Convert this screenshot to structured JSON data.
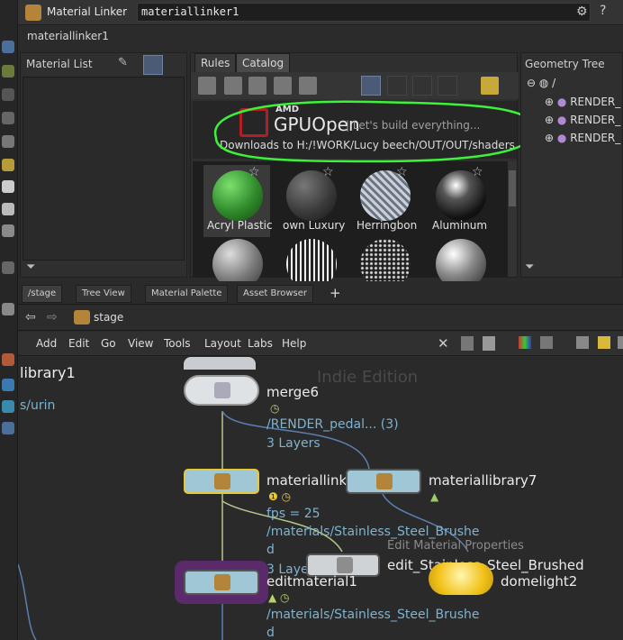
{
  "app": {
    "title": "Material Linker",
    "node_name": "materiallinker1",
    "node_path": "materiallinker1"
  },
  "panels": {
    "material_list": {
      "title": "Material List"
    },
    "catalog": {
      "tabs": [
        {
          "label": "Rules"
        },
        {
          "label": "Catalog"
        }
      ],
      "banner": {
        "brand_top": "AMD",
        "brand_main": "GPUOpen",
        "tagline": "| Let's build everything...",
        "download": "Downloads to H:/!WORK/Lucy beech/OUT/OUT/shaders"
      },
      "thumbnails": [
        {
          "label": "Acryl Plastic",
          "color": "#2f8a2a"
        },
        {
          "label": "own Luxury",
          "color": "#3b3b3b"
        },
        {
          "label": "Herringbon",
          "color": "#9aa3b0"
        },
        {
          "label": "Aluminum",
          "color": "#1d1d1d"
        }
      ]
    },
    "geometry_tree": {
      "title": "Geometry Tree",
      "root": "/",
      "items": [
        {
          "label": "RENDER_"
        },
        {
          "label": "RENDER_"
        },
        {
          "label": "RENDER_"
        }
      ]
    }
  },
  "network_tabs": [
    {
      "label": "/stage"
    },
    {
      "label": "Tree View"
    },
    {
      "label": "Material Palette"
    },
    {
      "label": "Asset Browser"
    }
  ],
  "path_bar": {
    "context": "stage"
  },
  "menu": [
    "Add",
    "Edit",
    "Go",
    "View",
    "Tools",
    "Layout",
    "Labs",
    "Help"
  ],
  "canvas": {
    "watermark": "Indie Edition",
    "left_labels": {
      "name": "library1",
      "sub": "s/urin"
    },
    "nodes": {
      "merge": {
        "name": "merge6",
        "path": "/RENDER_pedal... (3)",
        "layers": "3 Layers"
      },
      "linker": {
        "name": "materiallinker1",
        "fps": "fps = 25",
        "path_a": "/materials/Stainless_Steel_Brushe",
        "path_b": "d",
        "layers": "3 Layers"
      },
      "library": {
        "name": "materiallibrary7"
      },
      "edit_props": {
        "caption": "Edit Material Properties",
        "name": "edit_Stainless_Steel_Brushed"
      },
      "editmaterial": {
        "name": "editmaterial1",
        "path_a": "/materials/Stainless_Steel_Brushe",
        "path_b": "d"
      },
      "domelight": {
        "name": "domelight2"
      }
    }
  },
  "colors": {
    "accent": "#4b5b75",
    "highlight_ring": "#3df23a",
    "node_selected": "#e6c93a",
    "node_purple": "#5a2a6a"
  }
}
